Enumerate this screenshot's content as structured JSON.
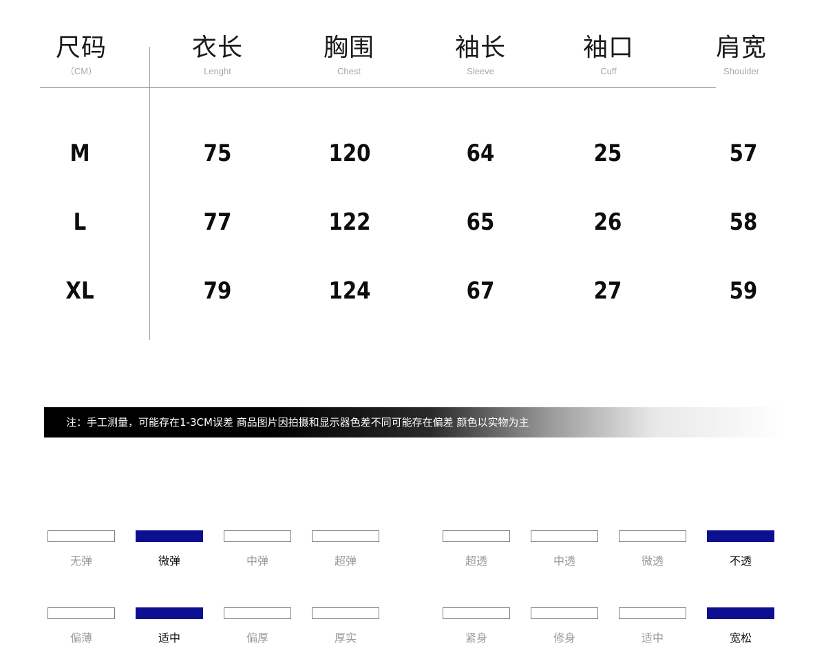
{
  "headers": [
    {
      "zh": "尺码",
      "en": "（CM）"
    },
    {
      "zh": "衣长",
      "en": "Lenght"
    },
    {
      "zh": "胸围",
      "en": "Chest"
    },
    {
      "zh": "袖长",
      "en": "Sleeve"
    },
    {
      "zh": "袖口",
      "en": "Cuff"
    },
    {
      "zh": "肩宽",
      "en": "Shoulder"
    }
  ],
  "rows": [
    [
      "M",
      "75",
      "120",
      "64",
      "25",
      "57"
    ],
    [
      "L",
      "77",
      "122",
      "65",
      "26",
      "58"
    ],
    [
      "XL",
      "79",
      "124",
      "67",
      "27",
      "59"
    ]
  ],
  "note": "注：手工测量，可能存在1-3CM误差  商品图片因拍摄和显示器色差不同可能存在偏差 颜色以实物为主",
  "attributes": {
    "elasticity": {
      "options": [
        "无弹",
        "微弹",
        "中弹",
        "超弹"
      ],
      "selected": "微弹"
    },
    "transparency": {
      "options": [
        "超透",
        "中透",
        "微透",
        "不透"
      ],
      "selected": "不透"
    },
    "thickness": {
      "options": [
        "偏薄",
        "适中",
        "偏厚",
        "厚实"
      ],
      "selected": "适中"
    },
    "fit": {
      "options": [
        "紧身",
        "修身",
        "适中",
        "宽松"
      ],
      "selected": "宽松"
    }
  },
  "colors": {
    "selected_fill": "#0c0f8f",
    "note_bar": "#000000"
  }
}
